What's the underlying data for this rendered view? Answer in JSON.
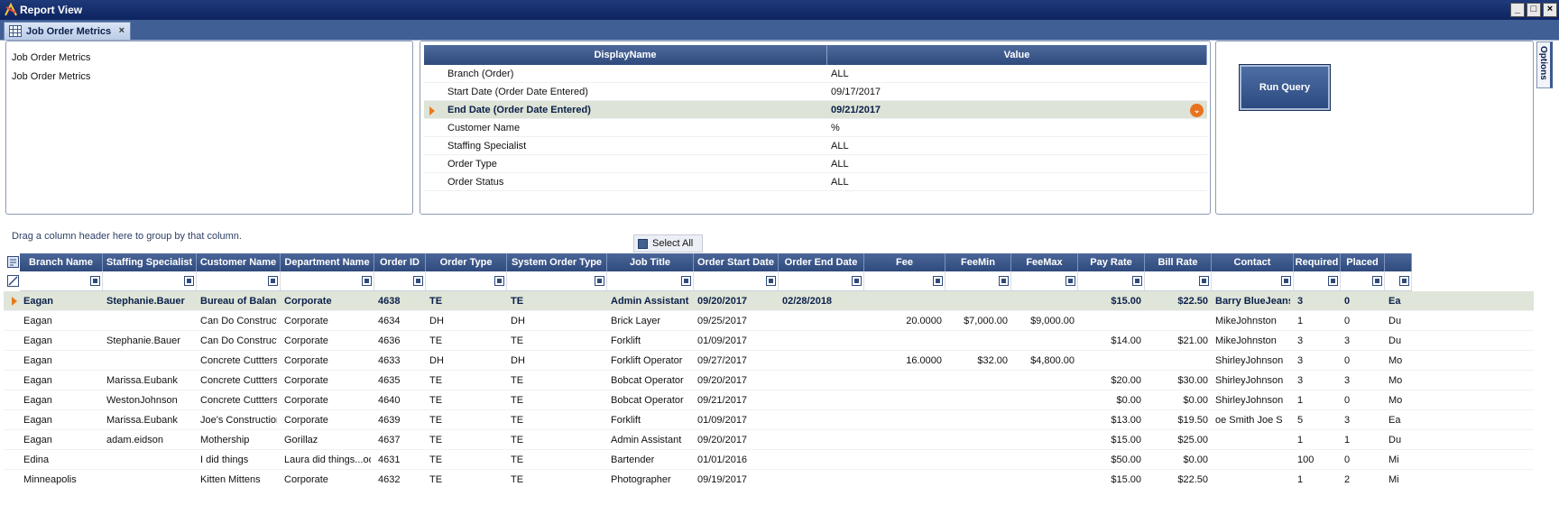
{
  "window": {
    "title": "Report View"
  },
  "tab": {
    "label": "Job Order Metrics",
    "close": "×"
  },
  "left_panel": {
    "items": [
      "Job Order Metrics",
      "Job Order Metrics"
    ]
  },
  "params": {
    "headers": [
      "DisplayName",
      "Value"
    ],
    "rows": [
      {
        "name": "Branch (Order)",
        "value": "ALL"
      },
      {
        "name": "Start Date (Order Date Entered)",
        "value": "09/17/2017"
      },
      {
        "name": "End Date (Order Date Entered)",
        "value": "09/21/2017"
      },
      {
        "name": "Customer Name",
        "value": "%"
      },
      {
        "name": "Staffing Specialist",
        "value": "ALL"
      },
      {
        "name": "Order Type",
        "value": "ALL"
      },
      {
        "name": "Order Status",
        "value": "ALL"
      }
    ],
    "selected_index": 2
  },
  "run_query": {
    "label": "Run Query"
  },
  "options_tab": {
    "label": "Options"
  },
  "group_hint": "Drag a column header here to group by that column.",
  "select_all": "Select All",
  "grid": {
    "columns": [
      "Branch Name",
      "Staffing Specialist",
      "Customer Name",
      "Department Name",
      "Order ID",
      "Order Type",
      "System Order Type",
      "Job Title",
      "Order Start Date",
      "Order End Date",
      "Fee",
      "FeeMin",
      "FeeMax",
      "Pay Rate",
      "Bill Rate",
      "Contact",
      "Required",
      "Placed",
      ""
    ],
    "rows": [
      [
        "Eagan",
        "Stephanie.Bauer",
        "Bureau of Balanc",
        "Corporate",
        "4638",
        "TE",
        "TE",
        "Admin Assistant",
        "09/20/2017",
        "02/28/2018",
        "",
        "",
        "",
        "$15.00",
        "$22.50",
        "Barry BlueJeans",
        "3",
        "0",
        "Ea"
      ],
      [
        "Eagan",
        "",
        "Can Do Constructi",
        "Corporate",
        "4634",
        "DH",
        "DH",
        "Brick Layer",
        "09/25/2017",
        "",
        "20.0000",
        "$7,000.00",
        "$9,000.00",
        "",
        "",
        "MikeJohnston",
        "1",
        "0",
        "Du"
      ],
      [
        "Eagan",
        "Stephanie.Bauer",
        "Can Do Constructi",
        "Corporate",
        "4636",
        "TE",
        "TE",
        "Forklift",
        "01/09/2017",
        "",
        "",
        "",
        "",
        "$14.00",
        "$21.00",
        "MikeJohnston",
        "3",
        "3",
        "Du"
      ],
      [
        "Eagan",
        "",
        "Concrete Cuttters",
        "Corporate",
        "4633",
        "DH",
        "DH",
        "Forklift Operator",
        "09/27/2017",
        "",
        "16.0000",
        "$32.00",
        "$4,800.00",
        "",
        "",
        "ShirleyJohnson",
        "3",
        "0",
        "Mo"
      ],
      [
        "Eagan",
        "Marissa.Eubank",
        "Concrete Cuttters",
        "Corporate",
        "4635",
        "TE",
        "TE",
        "Bobcat Operator",
        "09/20/2017",
        "",
        "",
        "",
        "",
        "$20.00",
        "$30.00",
        "ShirleyJohnson",
        "3",
        "3",
        "Mo"
      ],
      [
        "Eagan",
        "WestonJohnson",
        "Concrete Cuttters",
        "Corporate",
        "4640",
        "TE",
        "TE",
        "Bobcat Operator",
        "09/21/2017",
        "",
        "",
        "",
        "",
        "$0.00",
        "$0.00",
        "ShirleyJohnson",
        "1",
        "0",
        "Mo"
      ],
      [
        "Eagan",
        "Marissa.Eubank",
        "Joe's Construction",
        "Corporate",
        "4639",
        "TE",
        "TE",
        "Forklift",
        "01/09/2017",
        "",
        "",
        "",
        "",
        "$13.00",
        "$19.50",
        "oe  Smith Joe  S",
        "5",
        "3",
        "Ea"
      ],
      [
        "Eagan",
        "adam.eidson",
        "Mothership",
        "Gorillaz",
        "4637",
        "TE",
        "TE",
        "Admin Assistant",
        "09/20/2017",
        "",
        "",
        "",
        "",
        "$15.00",
        "$25.00",
        "",
        "1",
        "1",
        "Du"
      ],
      [
        "Edina",
        "",
        "I did things",
        "Laura did things...oo",
        "4631",
        "TE",
        "TE",
        "Bartender",
        "01/01/2016",
        "",
        "",
        "",
        "",
        "$50.00",
        "$0.00",
        "",
        "100",
        "0",
        "Mi"
      ],
      [
        "Minneapolis",
        "",
        "Kitten Mittens",
        "Corporate",
        "4632",
        "TE",
        "TE",
        "Photographer",
        "09/19/2017",
        "",
        "",
        "",
        "",
        "$15.00",
        "$22.50",
        "",
        "1",
        "2",
        "Mi"
      ]
    ],
    "selected_index": 0
  }
}
